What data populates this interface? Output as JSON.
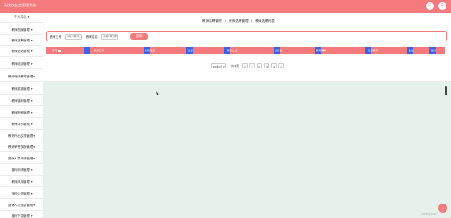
{
  "header": {
    "app_title": "高校校友会管理系统",
    "user_icon": "user-icon",
    "logout_icon": "power-icon"
  },
  "sidebar": {
    "items": [
      {
        "label": "个人中心"
      },
      {
        "label": "教师档案管理"
      },
      {
        "label": "教师选聘管理"
      },
      {
        "label": "教师绩效管理"
      },
      {
        "label": "教师培训管理"
      },
      {
        "label": "教师继续教育管理"
      },
      {
        "label": "教师奖惩管理"
      },
      {
        "label": "教师福利管理"
      },
      {
        "label": "教师职称管理"
      },
      {
        "label": "教师评价管理"
      },
      {
        "label": "教师外出交流管理"
      },
      {
        "label": "教师荣誉奖励管理"
      },
      {
        "label": "退休人员申请管理"
      },
      {
        "label": "福利申请管理"
      },
      {
        "label": "教师风采管理"
      },
      {
        "label": "学校公告管理"
      },
      {
        "label": "退休人员信息管理"
      },
      {
        "label": "福利下发管理"
      }
    ]
  },
  "breadcrumb": {
    "crumbs": [
      "教师选聘管理",
      "/",
      "教师选聘管理",
      "/",
      "教师选聘列表"
    ]
  },
  "search": {
    "teacher_id_label": "教师工号",
    "teacher_id_placeholder": "请输入教师工号",
    "teacher_name_label": "教师姓名",
    "teacher_name_placeholder": "请输入教师姓名",
    "submit_label": "查询"
  },
  "table": {
    "columns": [
      "序号",
      "教师工号",
      "教师姓名",
      "性别",
      "联系方式",
      "身份证",
      "职称等级",
      "技术职称",
      "备注",
      "操作"
    ]
  },
  "pagination": {
    "page_size": "10条/页",
    "total_label": "共4页",
    "prev": "<",
    "pages": [
      "1",
      "2",
      "3",
      "4"
    ],
    "next": ">"
  },
  "float_button": {
    "label": "+"
  },
  "watermark": "CSDN @xxxx",
  "colors": {
    "accent": "#f47a7e",
    "blue": "#3b62e8",
    "background": "#e6f1ec"
  }
}
